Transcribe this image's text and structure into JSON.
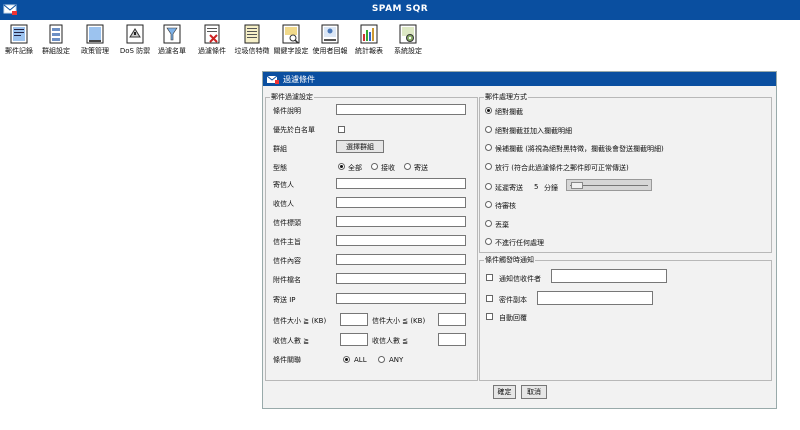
{
  "app": {
    "title": "SPAM SQR"
  },
  "toolbar": {
    "items": [
      {
        "label": "郵件記錄"
      },
      {
        "label": "群組設定"
      },
      {
        "label": "政策管理"
      },
      {
        "label": "DoS 防禦"
      },
      {
        "label": "過濾名單"
      },
      {
        "label": "過濾條件"
      },
      {
        "label": "垃圾信特徵"
      },
      {
        "label": "關鍵字設定"
      },
      {
        "label": "使用者回報"
      },
      {
        "label": "統計報表"
      },
      {
        "label": "系統設定"
      }
    ]
  },
  "window": {
    "title": "過濾條件",
    "filter": {
      "legend": "郵件過濾設定",
      "desc_label": "條件說明",
      "whitelist_label": "優先於白名單",
      "group_label": "群組",
      "group_button": "選擇群組",
      "type_label": "型態",
      "type_options": [
        "全部",
        "接收",
        "寄送"
      ],
      "sender_label": "寄信人",
      "recipient_label": "收信人",
      "header_label": "信件標頭",
      "subject_label": "信件主旨",
      "content_label": "信件內容",
      "attachment_label": "附件檔名",
      "ip_label": "寄送 IP",
      "size_ge_label": "信件大小 ≧ (KB)",
      "size_le_label": "信件大小 ≦ (KB)",
      "rcpt_ge_label": "收信人數 ≧",
      "rcpt_le_label": "收信人數 ≦",
      "relation_label": "條件關聯",
      "relation_options": [
        "ALL",
        "ANY"
      ]
    },
    "action": {
      "legend": "郵件處理方式",
      "options": [
        "絕對攔截",
        "絕對攔截並加入攔截明細",
        "候補攔截 (將視為絕對黑特徵，攔截後會發送攔截明細)",
        "放行 (符合此過濾條件之郵件即可正常傳送)",
        "延遲寄送",
        "待審核",
        "丟棄",
        "不進行任何處理"
      ],
      "delay_value": "5",
      "delay_unit": "分鐘",
      "delay_level": 0
    },
    "notify": {
      "legend": "條件觸發時通知",
      "notify_recipient": "通知信收件者",
      "bcc": "密件副本",
      "auto_reply": "自動回覆"
    },
    "ok_button": "確定",
    "cancel_button": "取消"
  },
  "colors": {
    "titlebar": "#0a4fa0",
    "panel": "#f2f2f2"
  }
}
